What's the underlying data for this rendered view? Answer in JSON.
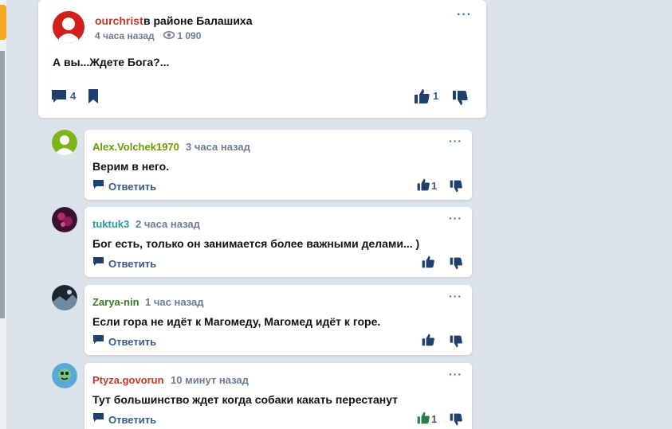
{
  "post": {
    "author": "ourchrist",
    "location": "в районе Балашиха",
    "time": "4 часа назад",
    "views": "1 090",
    "text": "А вы...Ждете Бога?...",
    "comments_count": "4",
    "likes": "1",
    "more_label": "···"
  },
  "reply_label": "Ответить",
  "comments": [
    {
      "author": "Alex.Volchek1970",
      "author_color": "#6b9a00",
      "time": "3 часа назад",
      "text": "Верим в него.",
      "likes": "1",
      "more_label": "···"
    },
    {
      "author": "tuktuk3",
      "author_color": "#2a9d8f",
      "time": "2 часа назад",
      "text": "Бог есть, только он занимается более важными делами... )",
      "likes": "",
      "more_label": "···"
    },
    {
      "author": "Zarya-nin",
      "author_color": "#3d7a1f",
      "time": "1 час назад",
      "text": "Если гора не идёт к Магомеду, Магомед идёт к горе.",
      "likes": "",
      "more_label": "···"
    },
    {
      "author": "Ptyza.govorun",
      "author_color": "#c0392b",
      "time": "10 минут назад",
      "text": "Тут большинство ждет когда собаки какать перестанут",
      "likes": "1",
      "more_label": "···"
    }
  ],
  "colors": {
    "accent": "#3a5a8c",
    "background": "#dde3ea",
    "active_like": "#2e7d4f"
  }
}
